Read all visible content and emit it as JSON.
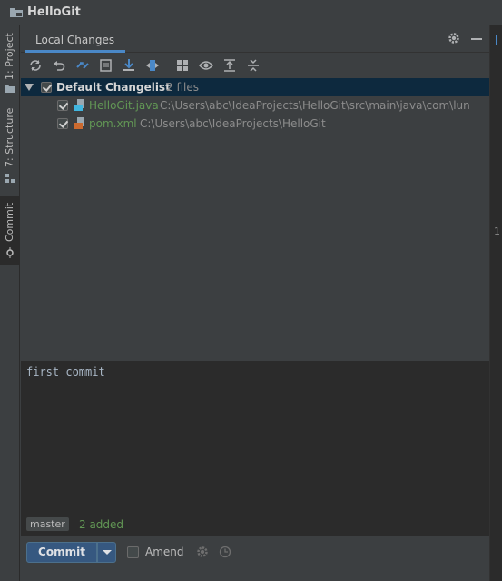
{
  "window": {
    "title": "HelloGit"
  },
  "left_tool_tabs": [
    {
      "label": "1: Project",
      "icon": "folder-icon",
      "active": false
    },
    {
      "label": "7: Structure",
      "icon": "structure-icon",
      "active": false
    },
    {
      "label": "Commit",
      "icon": "commit-icon",
      "active": true
    }
  ],
  "panel": {
    "tab_label": "Local Changes",
    "toolbar_icons": [
      "refresh-icon",
      "rollback-icon",
      "diff-icon",
      "shelve-icon",
      "update-icon",
      "move-icon",
      "group-by-icon",
      "view-options-icon",
      "expand-all-icon",
      "collapse-all-icon"
    ]
  },
  "changelist": {
    "name": "Default Changelist",
    "count": "2 files",
    "files": [
      {
        "name": "HelloGit.java",
        "path": "C:\\Users\\abc\\IdeaProjects\\HelloGit\\src\\main\\java\\com\\lun",
        "icon": "java-file-icon"
      },
      {
        "name": "pom.xml",
        "path": "C:\\Users\\abc\\IdeaProjects\\HelloGit",
        "icon": "maven-file-icon"
      }
    ]
  },
  "commit": {
    "message": "first commit",
    "branch": "master",
    "added_status": "2 added",
    "commit_button": "Commit",
    "amend_label": "Amend"
  },
  "right_strip": {
    "line_number": "1"
  },
  "colors": {
    "accent": "#4a88c7",
    "added_green": "#629755",
    "selection": "#0d293e"
  }
}
